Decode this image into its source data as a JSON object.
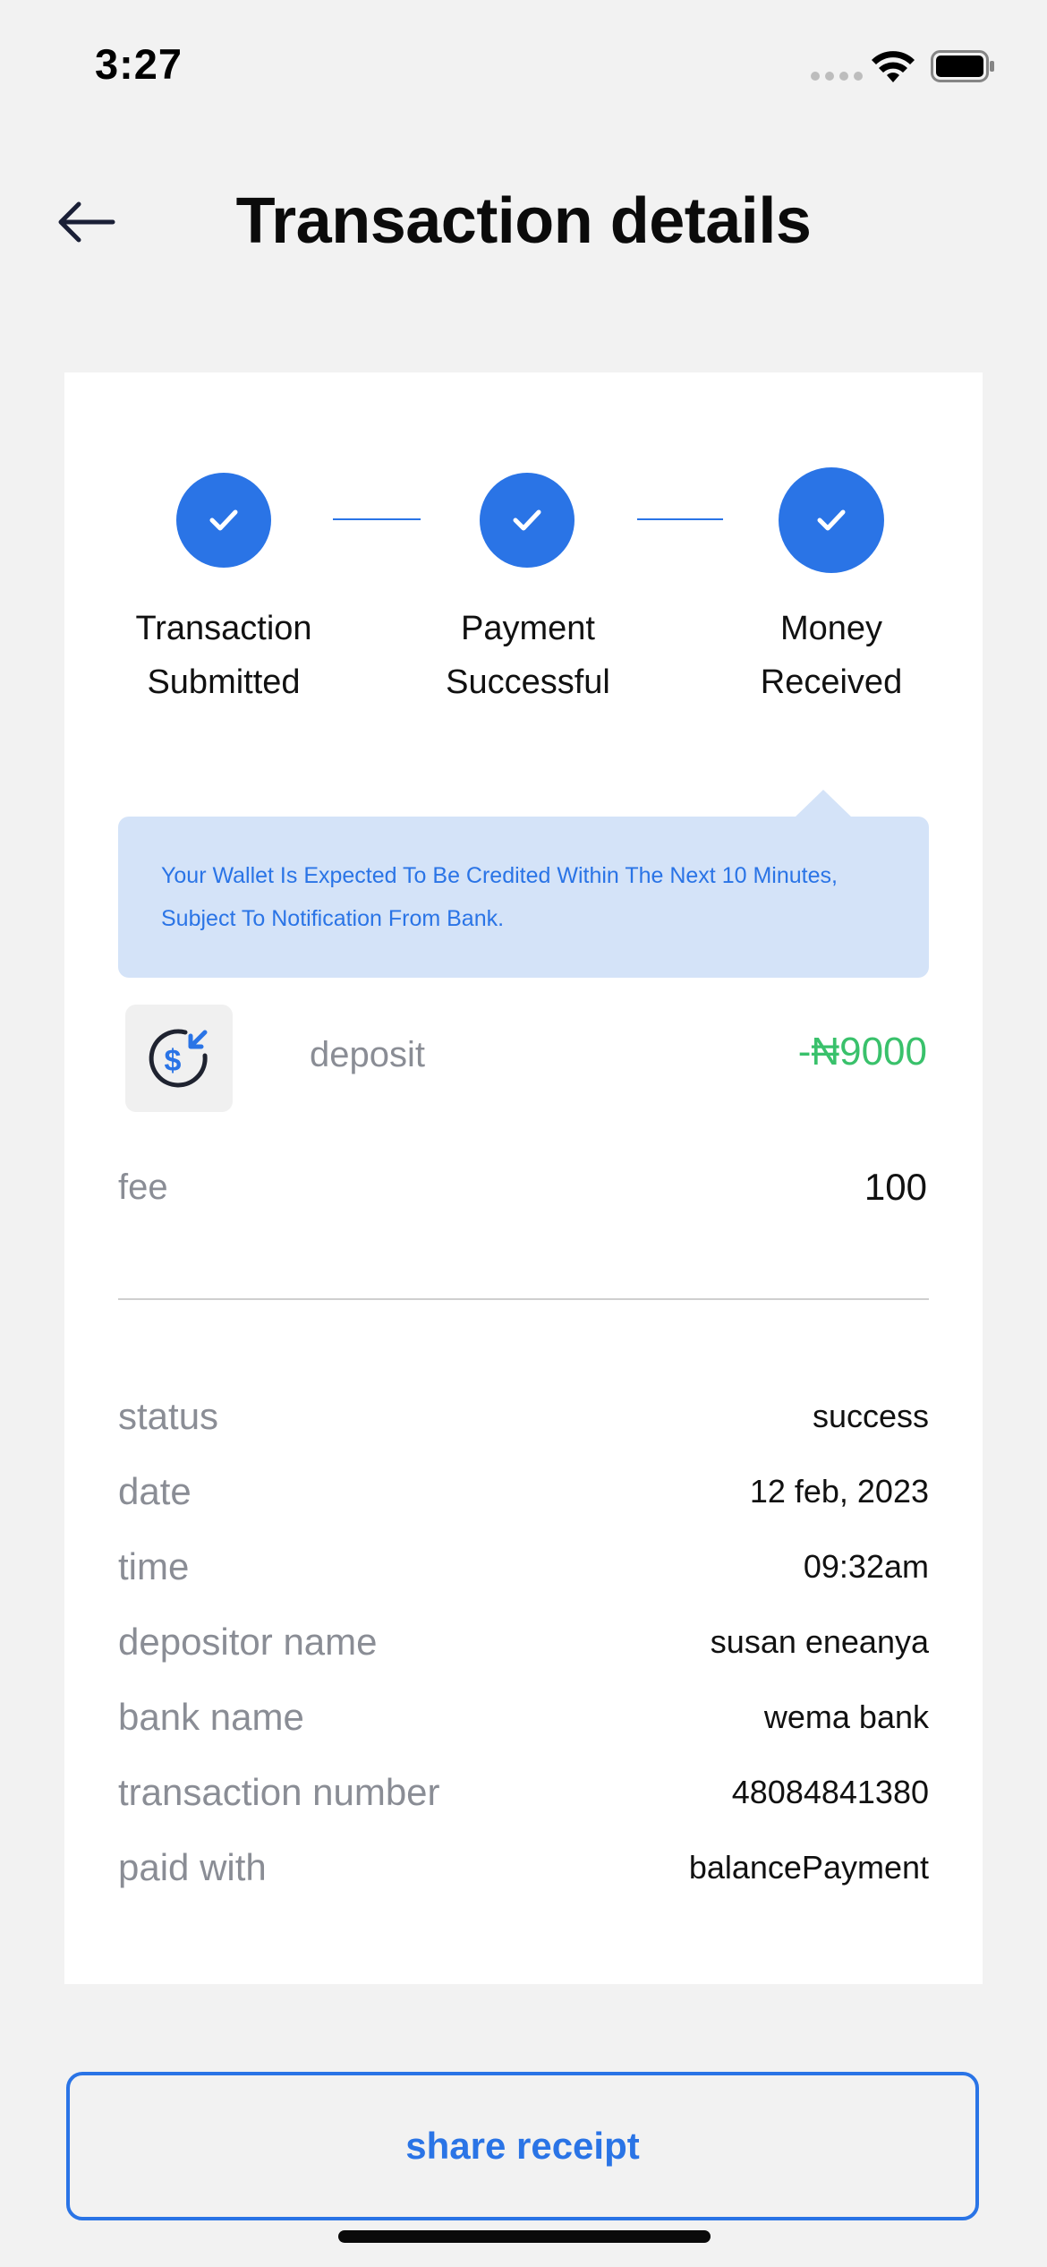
{
  "status_bar": {
    "time": "3:27"
  },
  "header": {
    "title": "Transaction details"
  },
  "steps": [
    {
      "line1": "Transaction",
      "line2": "Submitted"
    },
    {
      "line1": "Payment",
      "line2": "Successful"
    },
    {
      "line1": "Money",
      "line2": "Received"
    }
  ],
  "notice": {
    "text": "Your Wallet Is Expected To Be Credited Within The Next 10 Minutes, Subject To Notification From Bank."
  },
  "deposit": {
    "label": "deposit",
    "amount": "-₦9000",
    "amount_color": "#39c16b",
    "icon": "dollar-incoming-icon"
  },
  "fee": {
    "label": "fee",
    "value": "100"
  },
  "details": [
    {
      "label": "status",
      "value": "success"
    },
    {
      "label": "date",
      "value": "12 feb, 2023"
    },
    {
      "label": "time",
      "value": "09:32am"
    },
    {
      "label": "depositor name",
      "value": "susan eneanya"
    },
    {
      "label": "bank name",
      "value": "wema bank"
    },
    {
      "label": "transaction number",
      "value": "48084841380"
    },
    {
      "label": "paid with",
      "value": "balancePayment"
    }
  ],
  "actions": {
    "share_label": "share receipt"
  },
  "colors": {
    "accent": "#2a74e6",
    "notice_bg": "#d4e3f8",
    "background": "#f2f2f2"
  }
}
